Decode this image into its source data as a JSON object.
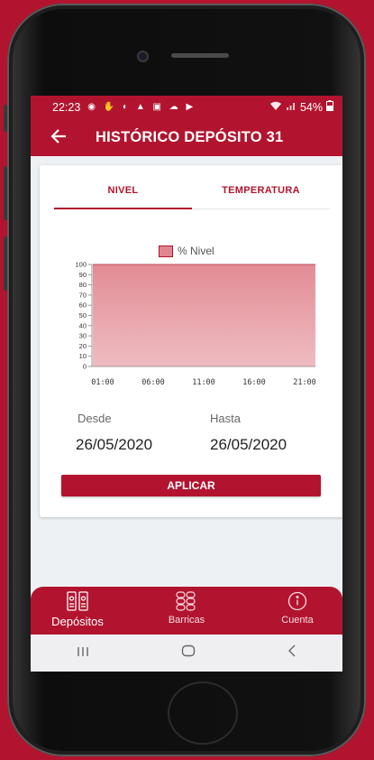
{
  "status_bar": {
    "time": "22:23",
    "notification_icons": [
      "messenger-icon",
      "hand-icon",
      "moon-icon",
      "bell-icon",
      "image-icon",
      "cloud-icon",
      "youtube-icon"
    ],
    "battery": "54%"
  },
  "app_bar": {
    "title": "HISTÓRICO DEPÓSITO 31"
  },
  "tabs": [
    {
      "label": "NIVEL",
      "active": true
    },
    {
      "label": "TEMPERATURA",
      "active": false
    }
  ],
  "chart_data": {
    "type": "area",
    "series": [
      {
        "name": "% Nivel",
        "color": "#e1868f",
        "x": [
          "01:00",
          "06:00",
          "11:00",
          "16:00",
          "21:00"
        ],
        "values": [
          100,
          100,
          100,
          100,
          100
        ]
      }
    ],
    "y_ticks": [
      "100",
      "90",
      "80",
      "70",
      "60",
      "50",
      "40",
      "30",
      "20",
      "10",
      "0"
    ],
    "x_ticks": [
      "01:00",
      "06:00",
      "11:00",
      "16:00",
      "21:00"
    ],
    "ylim": [
      0,
      100
    ],
    "legend_position": "top-center",
    "grid": false
  },
  "filters": {
    "from_label": "Desde",
    "from_value": "26/05/2020",
    "to_label": "Hasta",
    "to_value": "26/05/2020",
    "apply_label": "APLICAR"
  },
  "bottom_nav": [
    {
      "label": "Depósitos",
      "icon": "tanks-icon",
      "active": true
    },
    {
      "label": "Barricas",
      "icon": "barrels-icon",
      "active": false
    },
    {
      "label": "Cuenta",
      "icon": "info-icon",
      "active": false
    }
  ],
  "colors": {
    "brand": "#b2142f",
    "chart_fill": "#e1868f",
    "background": "#eef1f4"
  }
}
